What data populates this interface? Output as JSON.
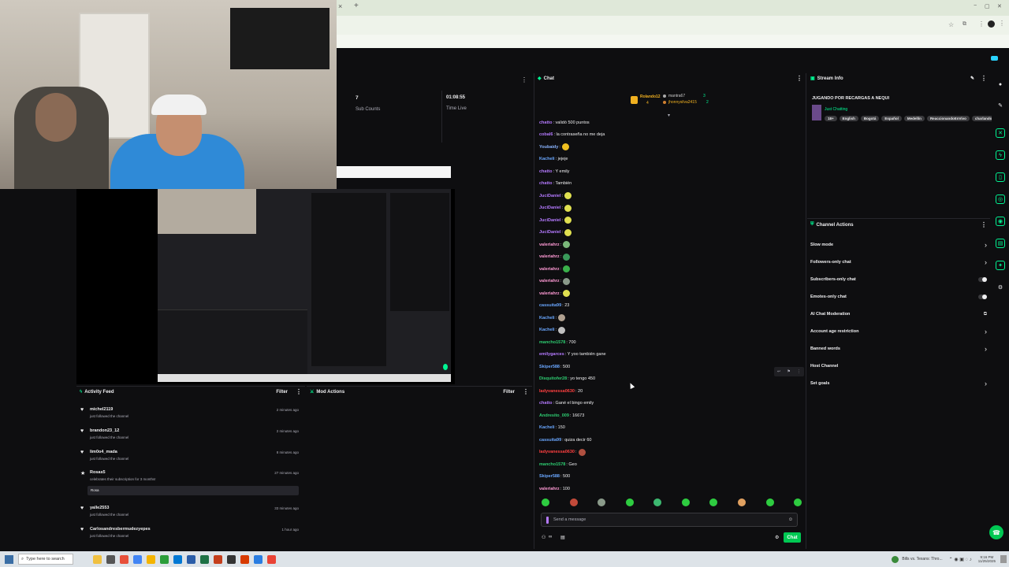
{
  "browser": {
    "new_tab": "+",
    "min": "−",
    "max": "▢",
    "close": "✕"
  },
  "stats": {
    "subs_value": "7",
    "subs_label": "Sub Counts",
    "time_value": "01:08:55",
    "time_label": "Time Live"
  },
  "chat": {
    "title": "Chat",
    "top_gifters": [
      {
        "name": "Rolando12",
        "count": "4"
      },
      {
        "name": "mantra67",
        "count": "3"
      },
      {
        "name": "jhonnysilva2415",
        "count": "2"
      }
    ],
    "messages": [
      {
        "user": "chatto",
        "text": ": validó 500 puntos",
        "color": "#b57aff"
      },
      {
        "user": "cobal6",
        "text": ": la contraseña no me deja",
        "color": "#b57aff"
      },
      {
        "user": "Youbaidy",
        "text": ":",
        "color": "#8ab4ff",
        "emote": "#f0c020"
      },
      {
        "user": "Kacheli",
        "text": ": jejeje",
        "color": "#6aa7ff"
      },
      {
        "user": "chatto",
        "text": ": Y emily",
        "color": "#b57aff"
      },
      {
        "user": "chatto",
        "text": ": También",
        "color": "#b57aff"
      },
      {
        "user": "JuciDaniel",
        "text": ":",
        "color": "#b57aff",
        "emote": "#e0e050"
      },
      {
        "user": "JuciDaniel",
        "text": ":",
        "color": "#b57aff",
        "emote": "#e0e050"
      },
      {
        "user": "JuciDaniel",
        "text": ":",
        "color": "#b57aff",
        "emote": "#e0e050"
      },
      {
        "user": "JuciDaniel",
        "text": ":",
        "color": "#b57aff",
        "emote": "#e0e050"
      },
      {
        "user": "valeriahrz",
        "text": ":",
        "color": "#ff9ad5",
        "emote": "#7ab87a"
      },
      {
        "user": "valeriahrz",
        "text": ":",
        "color": "#ff9ad5",
        "emote": "#3a9a5a"
      },
      {
        "user": "valeriahrz",
        "text": ":",
        "color": "#ff9ad5",
        "emote": "#3ab04a"
      },
      {
        "user": "valeriahrz",
        "text": ":",
        "color": "#ff9ad5",
        "emote": "#8a9a8a"
      },
      {
        "user": "valeriahrz",
        "text": ":",
        "color": "#ff9ad5",
        "emote": "#e0e050"
      },
      {
        "user": "cassuita99",
        "text": ": 23",
        "color": "#6aa7ff"
      },
      {
        "user": "Kacheli",
        "text": ":",
        "color": "#6aa7ff",
        "emote": "#b0a090"
      },
      {
        "user": "Kacheli",
        "text": ":",
        "color": "#6aa7ff",
        "emote": "#c0c0c0"
      },
      {
        "user": "mancho1578",
        "text": ": 700",
        "color": "#2ecc71"
      },
      {
        "user": "emilygarces",
        "text": ": Y yoo también gane",
        "color": "#b57aff"
      },
      {
        "user": "Skiper588",
        "text": ": 500",
        "color": "#6aa7ff"
      },
      {
        "user": "Disquitofer28",
        "text": ": yo tengo 450",
        "color": "#2ecc71"
      },
      {
        "user": "ladyvanessa0630",
        "text": ": 20",
        "color": "#ff4040"
      },
      {
        "user": "chatto",
        "text": ": Gané el bingo emily",
        "color": "#b57aff"
      },
      {
        "user": "Andresito_009",
        "text": ": 16673",
        "color": "#2ecc71"
      },
      {
        "user": "Kacheli",
        "text": ": 150",
        "color": "#6aa7ff"
      },
      {
        "user": "cassuita99",
        "text": ": quiza decir 60",
        "color": "#6aa7ff"
      },
      {
        "user": "ladyvanessa0630",
        "text": ":",
        "color": "#ff4040",
        "emote": "#b05040"
      },
      {
        "user": "mancho1578",
        "text": ": Geo",
        "color": "#2ecc71"
      },
      {
        "user": "Skiper588",
        "text": ": 500",
        "color": "#6aa7ff"
      },
      {
        "user": "valeriahrz",
        "text": ": 100",
        "color": "#ff9ad5"
      }
    ],
    "placeholder": "Send a message",
    "send_label": "Chat"
  },
  "stream_info": {
    "header": "Stream Info",
    "title": "JUGANDO POR RECARGAS A NEQUI",
    "category": "Just Chatting",
    "tags": [
      "18+",
      "English",
      "Bogotá",
      "Español",
      "Medellín",
      "ReaccionandoEnVivo",
      "charlando"
    ]
  },
  "channel_actions": {
    "header": "Channel Actions",
    "items": [
      {
        "label": "Slow mode",
        "control": "chevron"
      },
      {
        "label": "Followers-only chat",
        "control": "chevron"
      },
      {
        "label": "Subscribers-only chat",
        "control": "toggle"
      },
      {
        "label": "Emotes-only chat",
        "control": "toggle"
      },
      {
        "label": "AI Chat Moderation",
        "control": "external"
      },
      {
        "label": "Account age restriction",
        "control": "chevron"
      },
      {
        "label": "Banned words",
        "control": "chevron"
      },
      {
        "label": "Host Channel",
        "control": "none"
      },
      {
        "label": "Set goals",
        "control": "chevron"
      }
    ]
  },
  "activity": {
    "header": "Activity Feed",
    "filter": "Filter",
    "items": [
      {
        "name": "michel2119",
        "desc": "just followed the channel",
        "time": "2 minutes ago",
        "kind": "follow"
      },
      {
        "name": "brandon23_12",
        "desc": "just followed the channel",
        "time": "2 minutes ago",
        "kind": "follow"
      },
      {
        "name": "lim0o4_mada",
        "desc": "just followed the channel",
        "time": "8 minutes ago",
        "kind": "follow"
      },
      {
        "name": "Rosas5",
        "desc": "celebrates their subscription for 3 months!",
        "time": "27 minutes ago",
        "kind": "sub",
        "note": "Rosa"
      },
      {
        "name": "yalle2553",
        "desc": "just followed the channel",
        "time": "33 minutes ago",
        "kind": "follow"
      },
      {
        "name": "Carlosandresbermudezyepes",
        "desc": "just followed the channel",
        "time": "1 hour ago",
        "kind": "follow"
      }
    ]
  },
  "mod": {
    "header": "Mod Actions",
    "filter": "Filter"
  },
  "taskbar": {
    "search": "Type here to search",
    "weather": "Bills vs. Texans: Thro...",
    "time": "9:16 PM",
    "date": "11/25/2025"
  }
}
